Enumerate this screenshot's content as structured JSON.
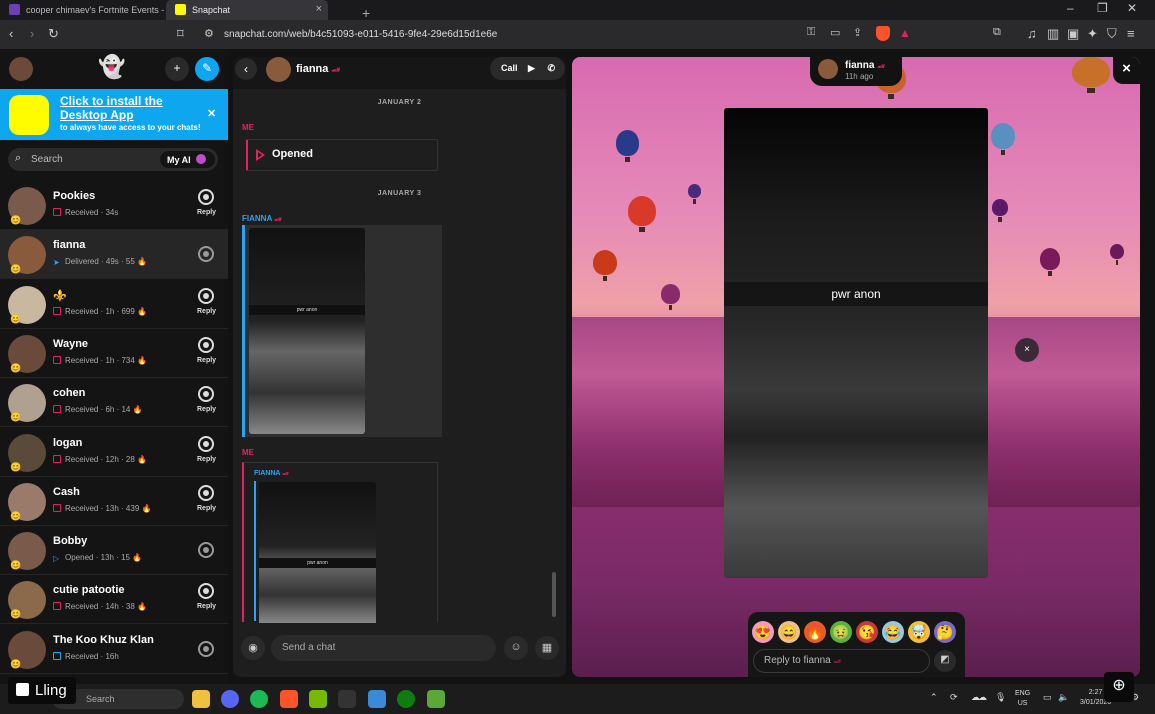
{
  "browser": {
    "tabs": [
      {
        "label": "cooper chimaev's Fortnite Events - Fo"
      },
      {
        "label": "Snapchat"
      }
    ],
    "new_tab_label": "+",
    "url": "snapchat.com/web/b4c51093-e011-5416-9fe4-29e6d15d1e6e"
  },
  "sidebar": {
    "banner": {
      "title": "Click to install the Desktop App",
      "subtitle": "to always have access to your chats!"
    },
    "search": {
      "placeholder": "Search",
      "my_ai_label": "My AI"
    },
    "reply_label": "Reply",
    "chats": [
      {
        "name": "Pookies",
        "status": "Received · 34s",
        "indicator": "red",
        "camera": "reply"
      },
      {
        "name": "fianna",
        "status": "Delivered · 49s · 55 🔥",
        "indicator": "blue-arrow",
        "camera": "dim",
        "selected": true
      },
      {
        "name": "⚜️",
        "status": "Received · 1h · 699 🔥",
        "indicator": "red",
        "camera": "reply"
      },
      {
        "name": "Wayne",
        "status": "Received · 1h · 734 🔥",
        "indicator": "red",
        "camera": "reply"
      },
      {
        "name": "cohen",
        "status": "Received · 6h · 14 🔥",
        "indicator": "red",
        "camera": "reply"
      },
      {
        "name": "logan",
        "status": "Received · 12h · 28 🔥",
        "indicator": "red",
        "camera": "reply"
      },
      {
        "name": "Cash",
        "status": "Received · 13h · 439 🔥",
        "indicator": "red",
        "camera": "reply"
      },
      {
        "name": "Bobby",
        "status": "Opened · 13h · 15 🔥",
        "indicator": "blue-arrow-open",
        "camera": "dim"
      },
      {
        "name": "cutie patootie",
        "status": "Received · 14h · 38 🔥",
        "indicator": "red",
        "camera": "reply"
      },
      {
        "name": "The Koo Khuz Klan",
        "status": "Received · 16h",
        "indicator": "blue-box",
        "camera": "dim"
      }
    ]
  },
  "chat": {
    "contact_name": "fianna",
    "call_label": "Call",
    "messages": {
      "date1": "JANUARY 2",
      "me_label": "ME",
      "opened_label": "Opened",
      "date2": "JANUARY 3",
      "fianna_label": "FIANNA",
      "snap_caption": "pwr anon",
      "me_label2": "ME",
      "quoted_label": "FIANNA",
      "quoted_caption": "pwr anon"
    },
    "input_placeholder": "Send a chat"
  },
  "story": {
    "user_name": "fianna",
    "time_ago": "11h ago",
    "caption": "pwr anon",
    "reply_placeholder": "Reply to fianna",
    "close_label": "×",
    "dismiss_label": "×"
  },
  "taskbar": {
    "search_placeholder": "Search",
    "overlay_label": "Lling",
    "lang": "ENG",
    "region": "US",
    "time": "2:27",
    "date": "3/01/2026"
  },
  "colors": {
    "snap_red": "#e0245e",
    "snap_blue": "#2ea3f2",
    "banner_blue": "#0ea6ef",
    "snap_yellow": "#fffc00"
  }
}
